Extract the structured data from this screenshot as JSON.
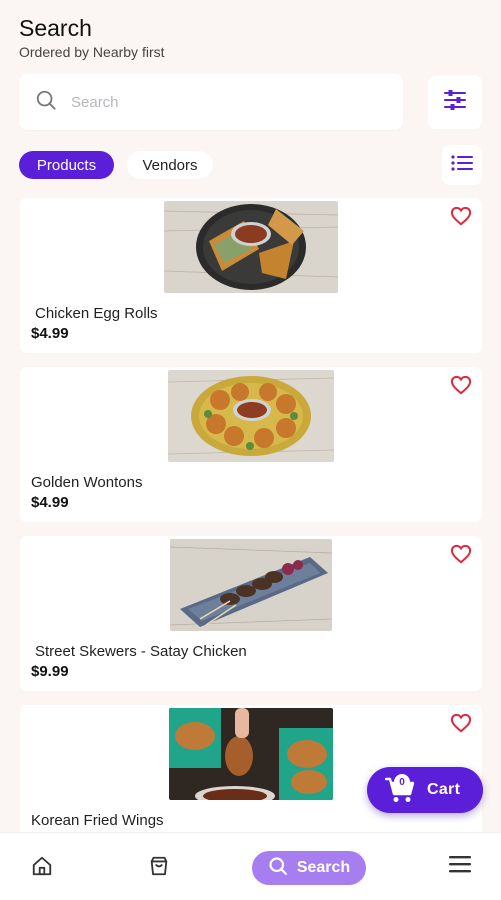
{
  "header": {
    "title": "Search",
    "subtitle": "Ordered by Nearby first"
  },
  "search": {
    "placeholder": "Search",
    "value": ""
  },
  "tabs": [
    {
      "label": "Products",
      "active": true
    },
    {
      "label": "Vendors",
      "active": false
    }
  ],
  "products": [
    {
      "name": "Chicken Egg Rolls",
      "price": "$4.99",
      "image": "egg-rolls-photo"
    },
    {
      "name": "Golden Wontons",
      "price": "$4.99",
      "image": "wontons-photo"
    },
    {
      "name": "Street Skewers - Satay Chicken",
      "price": "$9.99",
      "image": "skewers-photo"
    },
    {
      "name": "Korean Fried Wings",
      "price": "",
      "image": "wings-photo"
    }
  ],
  "cart": {
    "label": "Cart",
    "count": "0"
  },
  "bottom_nav": {
    "search_label": "Search"
  },
  "colors": {
    "accent": "#5b1fd9",
    "accent_light": "#a67ef0",
    "heart": "#e0283c",
    "background": "#fbf6f3"
  }
}
